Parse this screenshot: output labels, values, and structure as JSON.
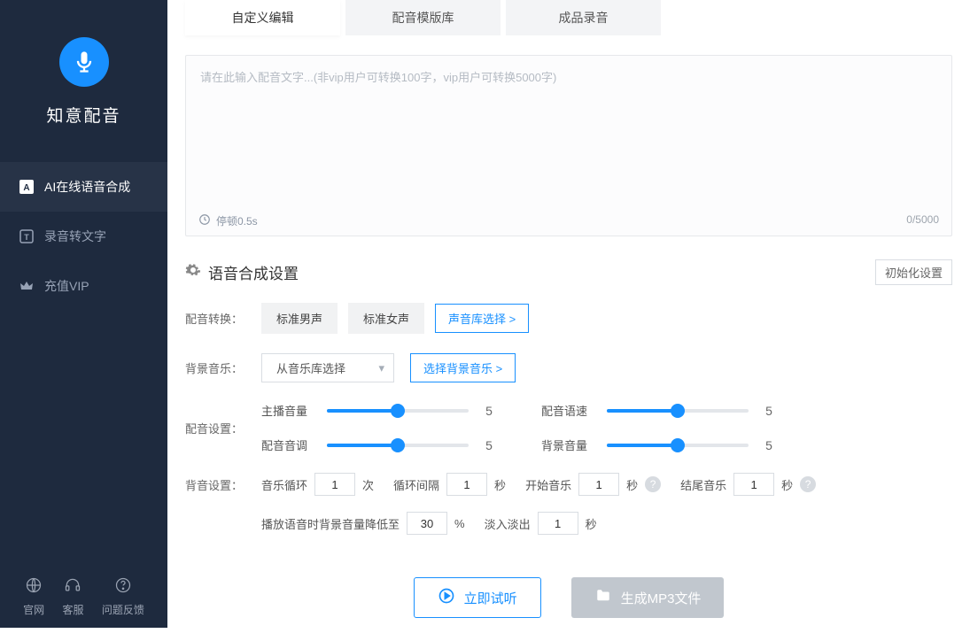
{
  "app": {
    "title": "知意配音"
  },
  "sidebar": {
    "items": [
      {
        "label": "AI在线语音合成"
      },
      {
        "label": "录音转文字"
      },
      {
        "label": "充值VIP"
      }
    ],
    "footer": [
      {
        "label": "官网"
      },
      {
        "label": "客服"
      },
      {
        "label": "问题反馈"
      }
    ]
  },
  "tabs": [
    {
      "label": "自定义编辑"
    },
    {
      "label": "配音模版库"
    },
    {
      "label": "成品录音"
    }
  ],
  "editor": {
    "placeholder": "请在此输入配音文字...(非vip用户可转换100字，vip用户可转换5000字)",
    "pause_label": "停顿0.5s",
    "counter": "0/5000"
  },
  "settings": {
    "title": "语音合成设置",
    "init_label": "初始化设置",
    "voice": {
      "row_label": "配音转换：",
      "male": "标准男声",
      "female": "标准女声",
      "choose": "声音库选择 >"
    },
    "bgm": {
      "row_label": "背景音乐：",
      "select_placeholder": "从音乐库选择",
      "choose": "选择背景音乐 >"
    },
    "dub": {
      "row_label": "配音设置：",
      "sliders": [
        {
          "label": "主播音量",
          "value": "5"
        },
        {
          "label": "配音语速",
          "value": "5"
        },
        {
          "label": "配音音调",
          "value": "5"
        },
        {
          "label": "背景音量",
          "value": "5"
        }
      ]
    },
    "bg": {
      "row_label": "背音设置：",
      "loop_label": "音乐循环",
      "loop_val": "1",
      "loop_unit": "次",
      "interval_label": "循环间隔",
      "interval_val": "1",
      "interval_unit": "秒",
      "start_label": "开始音乐",
      "start_val": "1",
      "start_unit": "秒",
      "end_label": "结尾音乐",
      "end_val": "1",
      "end_unit": "秒",
      "lower_label": "播放语音时背景音量降低至",
      "lower_val": "30",
      "lower_unit": "%",
      "fade_label": "淡入淡出",
      "fade_val": "1",
      "fade_unit": "秒"
    }
  },
  "actions": {
    "preview": "立即试听",
    "generate": "生成MP3文件"
  }
}
